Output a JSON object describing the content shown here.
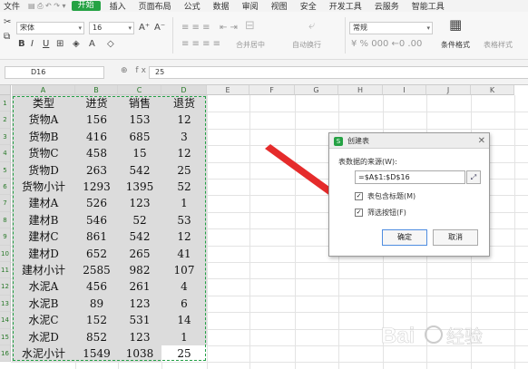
{
  "menubar": {
    "file": "文件",
    "tabs": [
      {
        "label": "开始",
        "active": true
      },
      {
        "label": "插入",
        "active": false
      },
      {
        "label": "页面布局",
        "active": false
      },
      {
        "label": "公式",
        "active": false
      },
      {
        "label": "数据",
        "active": false
      },
      {
        "label": "审阅",
        "active": false
      },
      {
        "label": "视图",
        "active": false
      },
      {
        "label": "安全",
        "active": false
      },
      {
        "label": "开发工具",
        "active": false
      },
      {
        "label": "云服务",
        "active": false
      },
      {
        "label": "智能工具",
        "active": false
      }
    ],
    "accent": "#25a244"
  },
  "ribbon": {
    "font_name": "宋体",
    "font_size": "16",
    "number_format": "常规",
    "merge_center": "合并居中",
    "wrap_text": "自动换行",
    "conditional_format": "条件格式",
    "table_style": "表格样式"
  },
  "formula_bar": {
    "cell_ref": "D16",
    "value": "25"
  },
  "sheet": {
    "columns": [
      "A",
      "B",
      "C",
      "D",
      "E",
      "F",
      "G",
      "H",
      "I",
      "J",
      "K"
    ],
    "rows": [
      "1",
      "2",
      "3",
      "4",
      "5",
      "6",
      "7",
      "8",
      "9",
      "10",
      "11",
      "12",
      "13",
      "14",
      "15",
      "16"
    ],
    "data": [
      [
        "类型",
        "进货",
        "销售",
        "退货"
      ],
      [
        "货物A",
        "156",
        "153",
        "12"
      ],
      [
        "货物B",
        "416",
        "685",
        "3"
      ],
      [
        "货物C",
        "458",
        "15",
        "12"
      ],
      [
        "货物D",
        "263",
        "542",
        "25"
      ],
      [
        "货物小计",
        "1293",
        "1395",
        "52"
      ],
      [
        "建材A",
        "526",
        "123",
        "1"
      ],
      [
        "建材B",
        "546",
        "52",
        "53"
      ],
      [
        "建材C",
        "861",
        "542",
        "12"
      ],
      [
        "建材D",
        "652",
        "265",
        "41"
      ],
      [
        "建材小计",
        "2585",
        "982",
        "107"
      ],
      [
        "水泥A",
        "456",
        "261",
        "4"
      ],
      [
        "水泥B",
        "89",
        "123",
        "6"
      ],
      [
        "水泥C",
        "152",
        "531",
        "14"
      ],
      [
        "水泥D",
        "852",
        "123",
        "1"
      ],
      [
        "水泥小计",
        "1549",
        "1038",
        "25"
      ]
    ],
    "marquee_color": "#23a046"
  },
  "dialog": {
    "title": "创建表",
    "source_label": "表数据的来源(W):",
    "range": "=$A$1:$D$16",
    "has_headers": {
      "label": "表包含标题(M)",
      "checked": true
    },
    "filter_buttons": {
      "label": "筛选按钮(F)",
      "checked": true
    },
    "ok": "确定",
    "cancel": "取消"
  },
  "watermark": "Bai 经验"
}
